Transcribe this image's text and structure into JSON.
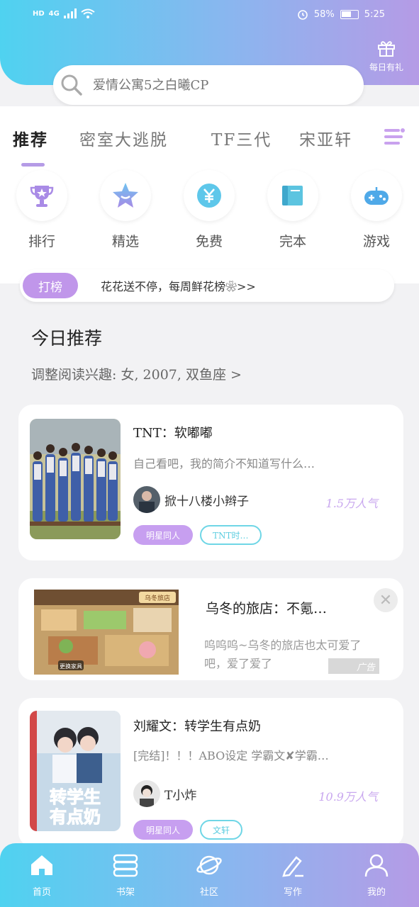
{
  "status": {
    "network": "HD",
    "signal": "4G",
    "battery": "58%",
    "time": "5:25"
  },
  "gift": {
    "label": "每日有礼"
  },
  "search": {
    "placeholder": "爱情公寓5之白曦CP"
  },
  "tabs": [
    {
      "label": "推荐",
      "active": true
    },
    {
      "label": "密室大逃脱",
      "active": false
    },
    {
      "label": "TF三代",
      "active": false
    },
    {
      "label": "宋亚轩",
      "active": false
    }
  ],
  "categories": [
    {
      "label": "排行",
      "icon": "trophy-icon",
      "color": "#a98be6"
    },
    {
      "label": "精选",
      "icon": "star-icon",
      "color": "#8f8de6"
    },
    {
      "label": "免费",
      "icon": "yuan-icon",
      "color": "#5ec7ea"
    },
    {
      "label": "完本",
      "icon": "book-icon",
      "color": "#5cc4e0"
    },
    {
      "label": "游戏",
      "icon": "gamepad-icon",
      "color": "#4fa9e8"
    }
  ],
  "notice": {
    "tag": "打榜",
    "text": "花花送不停，每周鲜花榜❀>>"
  },
  "section": {
    "title": "今日推荐",
    "subtitle": "调整阅读兴趣: 女, 2007, 双鱼座 >"
  },
  "books": [
    {
      "title": "TNT：软嘟嘟",
      "desc": "自己看吧，我的简介不知道写什么…",
      "author": "掀十八楼小辫子",
      "popularity": "1.5万人气",
      "tags": [
        "明星同人",
        "TNT时…"
      ]
    },
    {
      "title": "刘耀文：转学生有点奶",
      "desc": "[完结]！！！ABO设定 学霸文✘学霸…",
      "author": "T小炸",
      "popularity": "10.9万人气",
      "tags": [
        "明星同人",
        "文轩"
      ],
      "cover_text": "转学生有点奶"
    }
  ],
  "ad": {
    "title": "乌冬的旅店：不氪…",
    "desc": "呜呜呜~乌冬的旅店也太可爱了吧，爱了爱了",
    "label": "广告",
    "image_caption": "更换家具",
    "image_logo": "乌冬旅店"
  },
  "bottom_nav": [
    {
      "label": "首页",
      "icon": "home-icon"
    },
    {
      "label": "书架",
      "icon": "bookshelf-icon"
    },
    {
      "label": "社区",
      "icon": "planet-icon"
    },
    {
      "label": "写作",
      "icon": "pen-icon"
    },
    {
      "label": "我的",
      "icon": "profile-icon"
    }
  ]
}
